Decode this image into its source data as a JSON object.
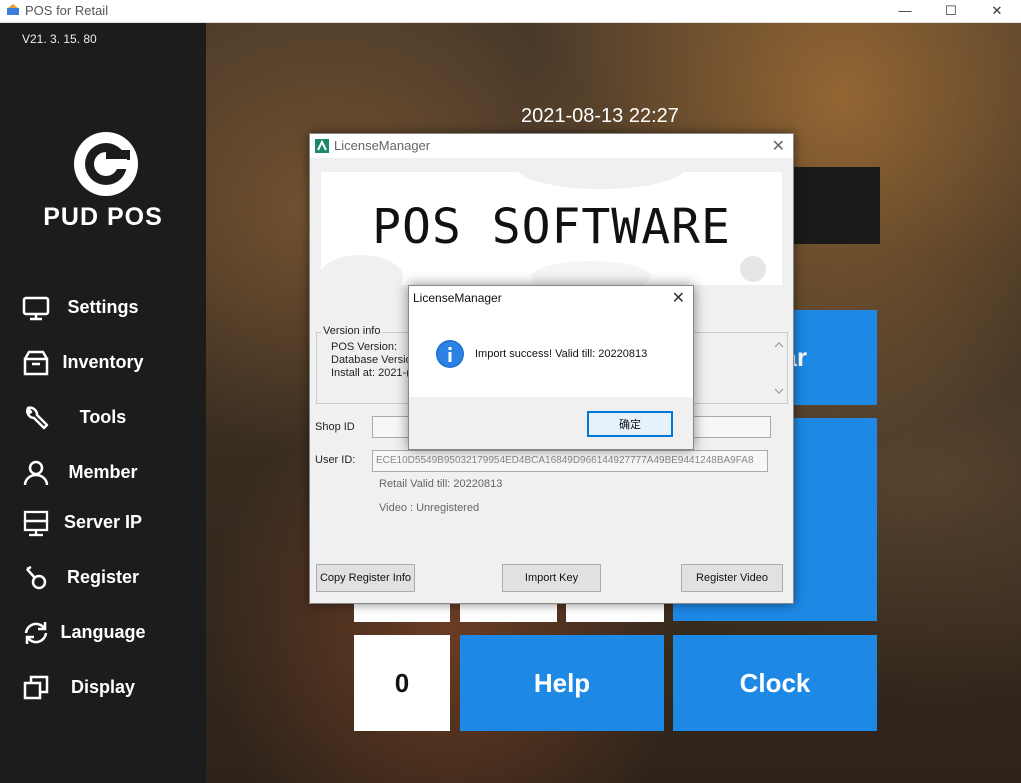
{
  "window": {
    "title": "POS for Retail",
    "minimize": "—",
    "maximize": "☐",
    "close": "✕"
  },
  "sidebar": {
    "version": "V21. 3. 15. 80",
    "brand": "PUD POS",
    "items": [
      {
        "label": "Settings",
        "icon": "monitor-icon"
      },
      {
        "label": "Inventory",
        "icon": "box-icon"
      },
      {
        "label": "Tools",
        "icon": "wrench-icon"
      },
      {
        "label": "Member",
        "icon": "user-icon"
      },
      {
        "label": "Server IP",
        "icon": "server-icon"
      },
      {
        "label": "Register",
        "icon": "key-icon"
      },
      {
        "label": "Language",
        "icon": "refresh-icon"
      },
      {
        "label": "Display",
        "icon": "windows-icon"
      }
    ]
  },
  "main": {
    "datetime": "2021-08-13 22:27",
    "tiles": {
      "partial_right": "ar",
      "zero": "0",
      "help": "Help",
      "clock": "Clock"
    }
  },
  "license_manager": {
    "title": "LicenseManager",
    "banner": "POS SOFTWARE",
    "version_info": {
      "legend": "Version info",
      "pos_version": "POS Version:",
      "database_version": "Database Versio",
      "install_at": "Install at: 2021-("
    },
    "shop_id_label": "Shop ID",
    "user_id_label": "User ID:",
    "user_id_value": "ECE10D5549B95032179954ED4BCA16849D966144927777A49BE9441248BA9FA8",
    "retail_valid": "Retail Valid till: 20220813",
    "video_status": "Video : Unregistered",
    "buttons": {
      "copy": "Copy Register Info",
      "import": "Import Key",
      "register_video": "Register Video"
    }
  },
  "message_box": {
    "title": "LicenseManager",
    "message": "Import success! Valid till: 20220813",
    "ok": "确定"
  },
  "colors": {
    "accent_blue": "#1e88e5",
    "sidebar_bg": "#1c1c1c",
    "dialog_bg": "#f0f0f0"
  }
}
